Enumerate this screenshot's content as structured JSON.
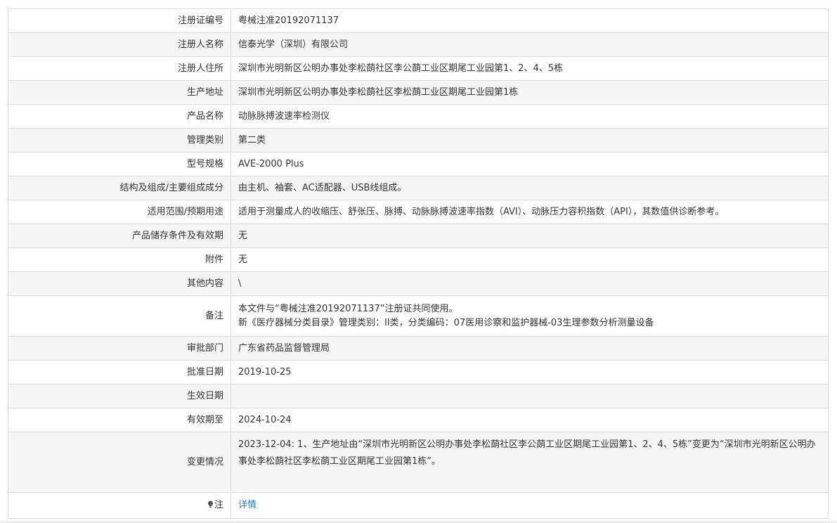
{
  "rows": [
    {
      "label": "注册证编号",
      "value": "粤械注准20192071137"
    },
    {
      "label": "注册人名称",
      "value": "信泰光学（深圳）有限公司"
    },
    {
      "label": "注册人住所",
      "value": "深圳市光明新区公明办事处李松蓢社区李公蓢工业区期尾工业园第1、2、4、5栋"
    },
    {
      "label": "生产地址",
      "value": "深圳市光明新区公明办事处李松蓢社区李松蓢工业区期尾工业园第1栋"
    },
    {
      "label": "产品名称",
      "value": "动脉脉搏波速率检测仪"
    },
    {
      "label": "管理类别",
      "value": "第二类"
    },
    {
      "label": "型号规格",
      "value": "AVE-2000 Plus"
    },
    {
      "label": "结构及组成/主要组成成分",
      "value": "由主机、袖套、AC适配器、USB线组成。"
    },
    {
      "label": "适用范围/预期用途",
      "value": "适用于测量成人的收缩压、舒张压、脉搏、动脉脉搏波速率指数（AVI）、动脉压力容积指数（API），其数值供诊断参考。"
    },
    {
      "label": "产品储存条件及有效期",
      "value": "无"
    },
    {
      "label": "附件",
      "value": "无"
    },
    {
      "label": "其他内容",
      "value": "\\"
    }
  ],
  "remark": {
    "label": "备注",
    "line1": "本文件与“粤械注准20192071137”注册证共同使用。",
    "line2": "新《医疗器械分类目录》管理类别：II类，分类编码：07医用诊察和监护器械-03生理参数分析测量设备"
  },
  "rows2": [
    {
      "label": "审批部门",
      "value": "广东省药品监督管理局"
    },
    {
      "label": "批准日期",
      "value": "2019-10-25"
    },
    {
      "label": "生效日期",
      "value": ""
    },
    {
      "label": "有效期至",
      "value": "2024-10-24"
    }
  ],
  "change": {
    "label": "变更情况",
    "value": "2023-12-04: 1、生产地址由“深圳市光明新区公明办事处李松蓢社区李公蓢工业区期尾工业园第1、2、4、5栋”变更为“深圳市光明新区公明办事处李松蓢社区李松蓢工业区期尾工业园第1栋”。"
  },
  "note": {
    "label": "注",
    "icon": "lightbulb-icon",
    "link_text": "详情",
    "link_color": "#1e7fd6"
  }
}
